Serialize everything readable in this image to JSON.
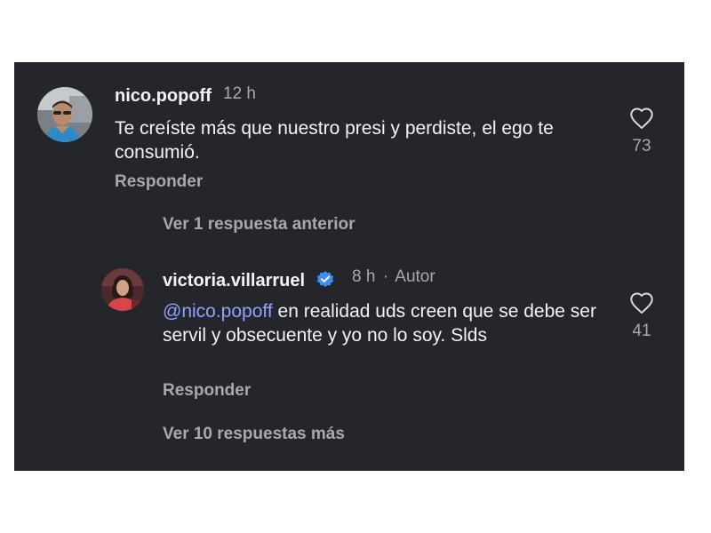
{
  "comment": {
    "username": "nico.popoff",
    "time": "12 h",
    "text": "Te creíste más que nuestro presi y perdiste, el ego te consumió.",
    "reply_label": "Responder",
    "like_count": "73",
    "like_icon": "heart-outline-icon"
  },
  "thread": {
    "previous_replies_label": "Ver 1 respuesta anterior",
    "more_replies_label": "Ver 10 respuestas más"
  },
  "reply": {
    "username": "victoria.villarruel",
    "verified_icon": "verified-badge-icon",
    "time": "8 h",
    "separator": "·",
    "author_tag": "Autor",
    "mention": "@nico.popoff",
    "text": " en realidad uds creen que se debe ser servil y obsecuente y yo no lo soy. Slds",
    "reply_label": "Responder",
    "like_count": "41",
    "like_icon": "heart-outline-icon"
  },
  "colors": {
    "background": "#25262b",
    "primary_text": "#f2f3f5",
    "secondary_text": "#a7a9ae",
    "mention": "#8fa3ff",
    "verified": "#3d8ef8"
  }
}
